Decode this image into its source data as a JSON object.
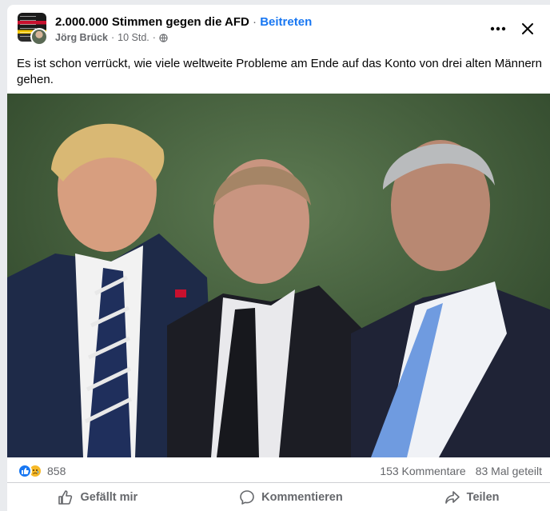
{
  "post": {
    "group_name": "2.000.000 Stimmen gegen die AFD",
    "separator": "·",
    "join_label": "Beitreten",
    "author": "Jörg Brück",
    "meta_separator": "·",
    "time": "10 Std.",
    "privacy_icon": "globe-icon",
    "text": "Es ist schon verrückt, wie viele weltweite Probleme am Ende auf das Konto von drei alten Männern gehen."
  },
  "header_actions": {
    "more_icon": "more-horizontal-icon",
    "close_icon": "close-icon"
  },
  "stats": {
    "reaction_icons": [
      "like-icon",
      "sad-icon"
    ],
    "reaction_count": "858",
    "comments": "153 Kommentare",
    "shares": "83 Mal geteilt"
  },
  "actions": {
    "like": "Gefällt mir",
    "comment": "Kommentieren",
    "share": "Teilen"
  },
  "colors": {
    "accent": "#1877f2",
    "secondary_text": "#65676b",
    "sad_reaction": "#f7b928"
  }
}
